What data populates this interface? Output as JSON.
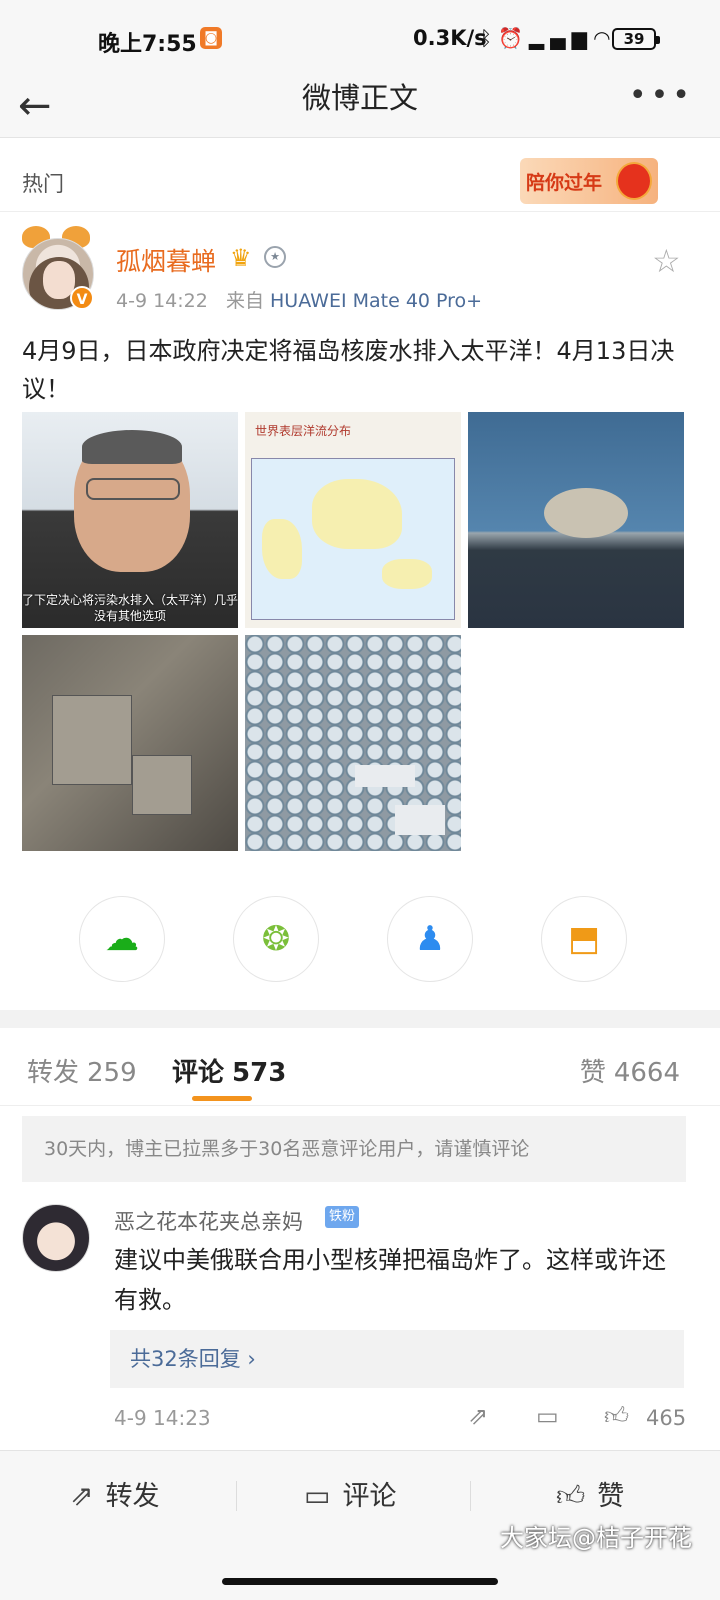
{
  "status_bar": {
    "time": "晚上7:55",
    "network_speed": "0.3K/s",
    "icons": [
      "bluetooth-icon",
      "alarm-icon",
      "hd-signal-icon",
      "wifi-icon"
    ],
    "battery": "39"
  },
  "nav": {
    "title": "微博正文",
    "back_icon": "back-arrow-icon",
    "more_icon": "more-dots-icon"
  },
  "hot_bar": {
    "label": "热门",
    "banner_text": "陪你过年"
  },
  "post": {
    "username": "孤烟暮蝉",
    "meta_time": "4-9 14:22",
    "meta_source_prefix": "来自",
    "meta_device": "HUAWEI Mate 40 Pro+",
    "text": "4月9日，日本政府决定将福岛核废水排入太平洋！4月13日决议！",
    "images": [
      {
        "caption": "了下定决心将污染水排入（太平洋）几乎没有其他选项"
      },
      {
        "caption": "世界表层洋流分布"
      },
      {
        "caption": ""
      },
      {
        "caption": ""
      },
      {
        "caption": ""
      }
    ]
  },
  "share": {
    "buttons": [
      "wechat-icon",
      "moments-icon",
      "qq-icon",
      "save-image-icon"
    ]
  },
  "tabs": {
    "repost_label": "转发",
    "repost_count": "259",
    "comment_label": "评论",
    "comment_count": "573",
    "like_label": "赞",
    "like_count": "4664"
  },
  "notice": "30天内，博主已拉黑多于30名恶意评论用户，请谨慎评论",
  "comment": {
    "username": "恶之花本花夹总亲妈",
    "badge": "铁粉",
    "text": "建议中美俄联合用小型核弹把福岛炸了。这样或许还有救。",
    "replies": "共32条回复 ›",
    "time": "4-9 14:23",
    "like_count": "465"
  },
  "bottom_bar": {
    "repost": "转发",
    "comment": "评论",
    "like": "赞"
  },
  "watermark": "大家坛@桔子开花"
}
